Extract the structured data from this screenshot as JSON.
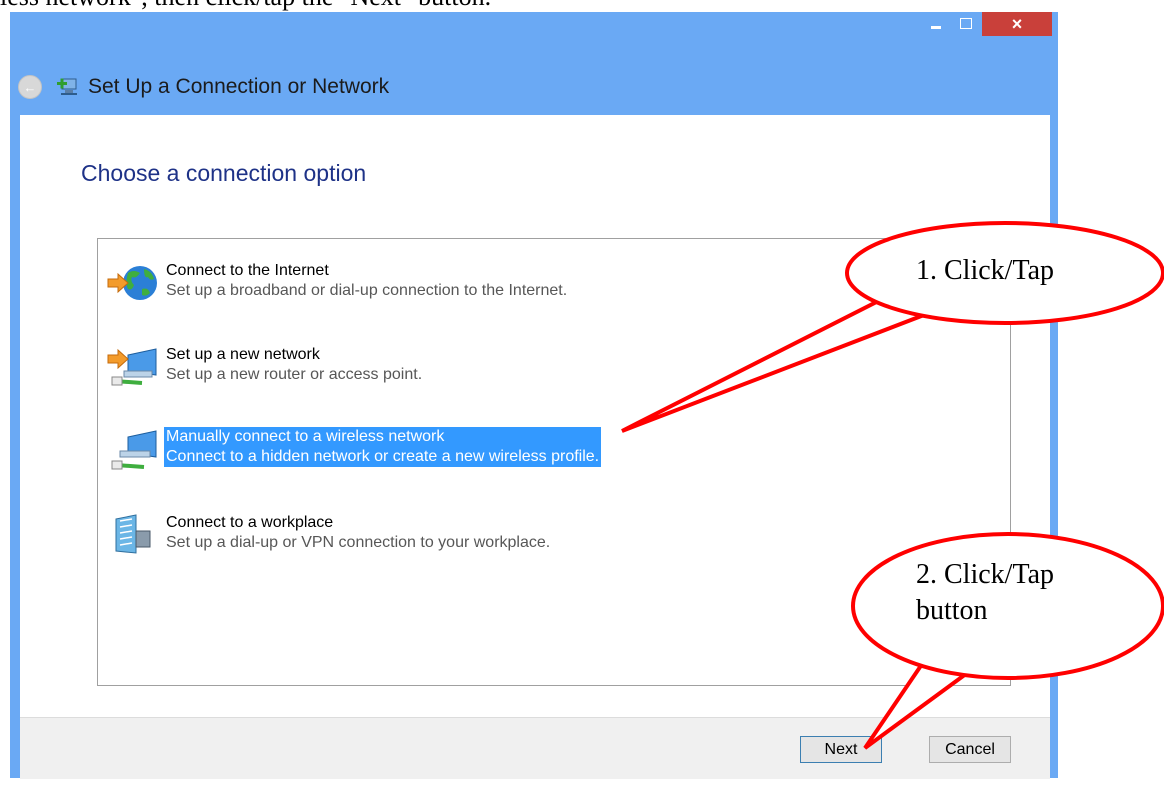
{
  "caption": "less network\", then click/tap the \"Next\" button.",
  "window": {
    "title": "Set Up a Connection or Network",
    "controls": {
      "minimize": "minimize",
      "maximize": "maximize",
      "close": "×"
    }
  },
  "heading": "Choose a connection option",
  "options": [
    {
      "title": "Connect to the Internet",
      "description": "Set up a broadband or dial-up connection to the Internet.",
      "icon": "globe-internet-icon",
      "selected": false
    },
    {
      "title": "Set up a new network",
      "description": "Set up a new router or access point.",
      "icon": "new-network-icon",
      "selected": false
    },
    {
      "title": "Manually connect to a wireless network",
      "description": "Connect to a hidden network or create a new wireless profile.",
      "icon": "wireless-network-icon",
      "selected": true
    },
    {
      "title": "Connect to a workplace",
      "description": "Set up a dial-up or VPN connection to your workplace.",
      "icon": "workplace-icon",
      "selected": false
    }
  ],
  "buttons": {
    "next": "Next",
    "cancel": "Cancel"
  },
  "callouts": [
    {
      "text": "1. Click/Tap"
    },
    {
      "text_line1": "2. Click/Tap",
      "text_line2": "button"
    }
  ],
  "colors": {
    "title_bar": "#6aa9f4",
    "close_button": "#c9403a",
    "heading": "#1e3287",
    "selection": "#3399ff",
    "callout_outline": "#ff0000"
  }
}
